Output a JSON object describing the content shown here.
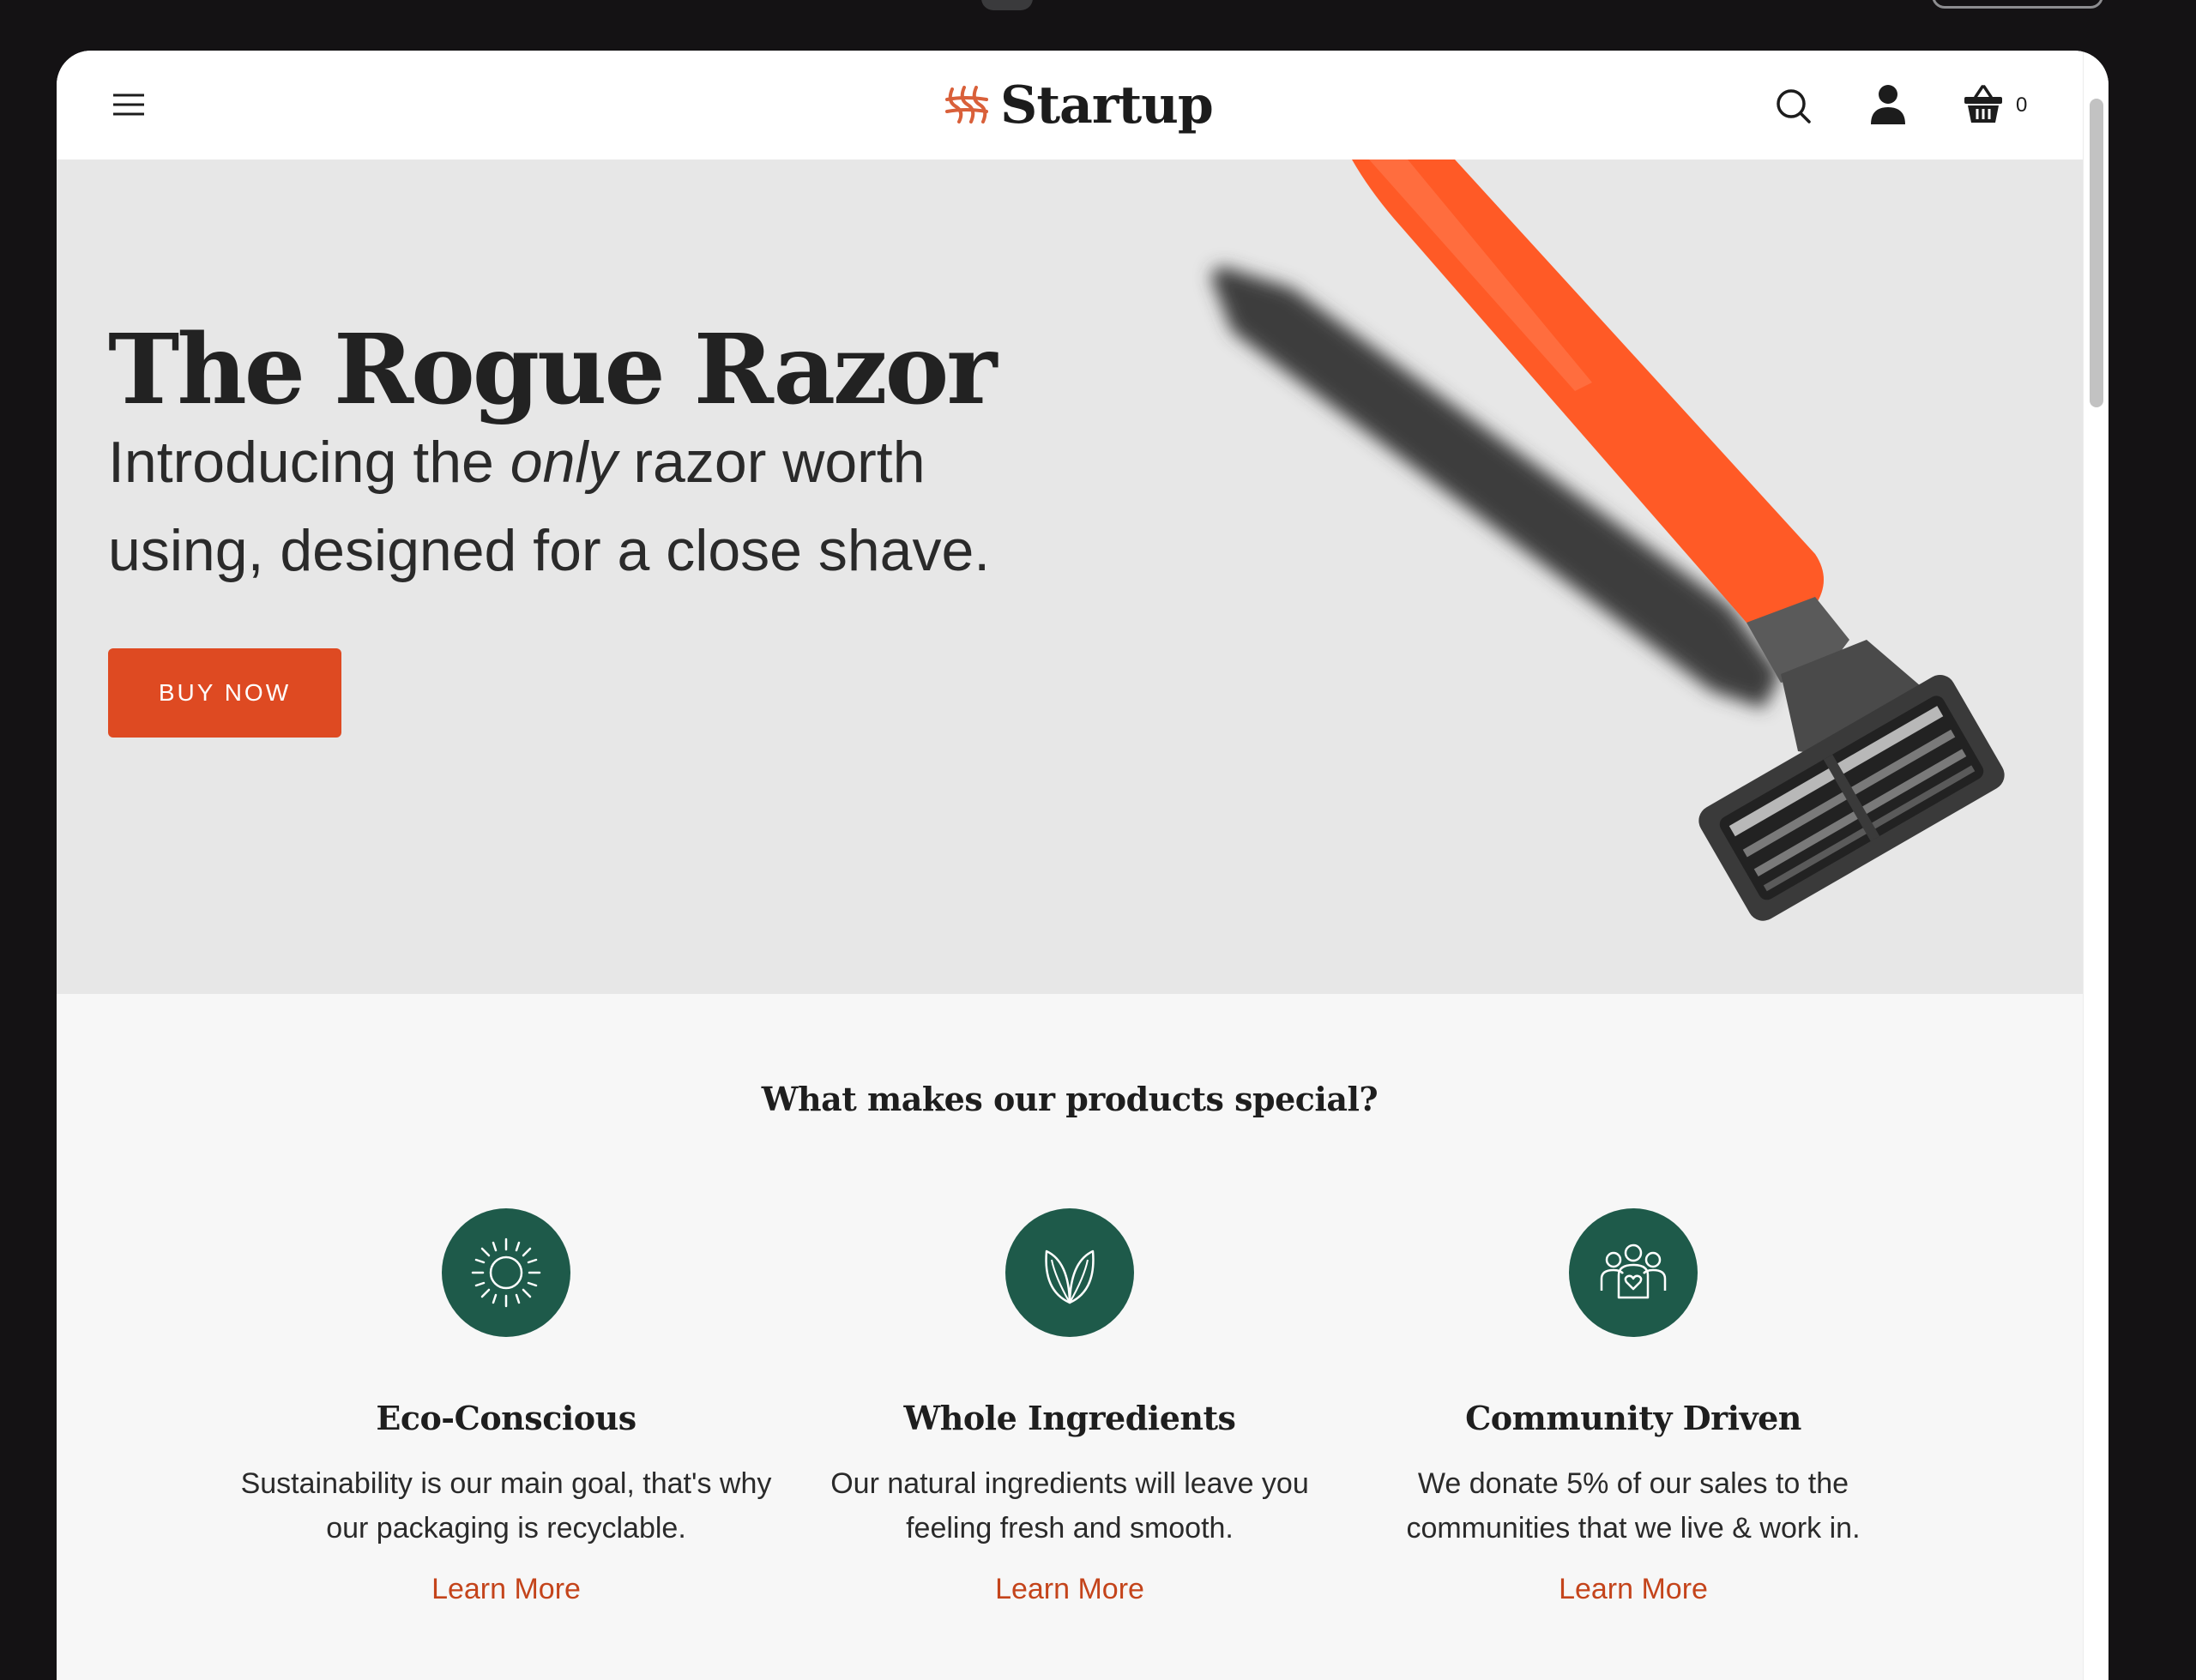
{
  "header": {
    "brand": "Startup",
    "cart_count": "0"
  },
  "hero": {
    "title": "The Rogue Razor",
    "subtitle_before": "Introducing the ",
    "subtitle_emphasis": "only",
    "subtitle_after": " razor worth using, designed for a close shave.",
    "button_label": "BUY NOW"
  },
  "features": {
    "heading": "What makes our products special?",
    "items": [
      {
        "icon": "sun-icon",
        "title": "Eco-Conscious",
        "text": "Sustainability is our main goal, that's why our packaging is recyclable.",
        "link": "Learn More"
      },
      {
        "icon": "leaf-icon",
        "title": "Whole Ingredients",
        "text": "Our natural ingredients will leave you feeling fresh and smooth.",
        "link": "Learn More"
      },
      {
        "icon": "community-icon",
        "title": "Community Driven",
        "text": "We donate 5% of our sales to the communities that we live & work in.",
        "link": "Learn More"
      }
    ]
  },
  "colors": {
    "accent": "#de4a22",
    "link": "#c4441b",
    "feature_icon_bg": "#1e5a4a",
    "hero_bg": "#e7e7e7"
  }
}
